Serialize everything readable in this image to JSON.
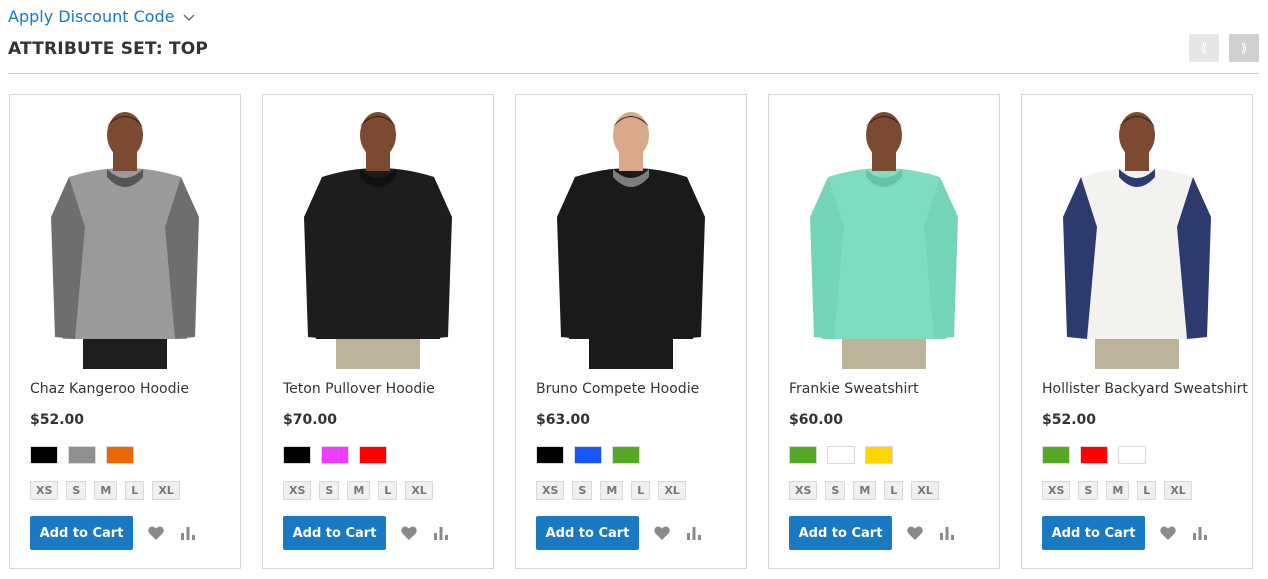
{
  "discount": {
    "label": "Apply Discount Code"
  },
  "section": {
    "title": "ATTRIBUTE SET: TOP"
  },
  "carousel": {
    "prev_glyph": "⟪",
    "next_glyph": "⟫"
  },
  "colors": {
    "accent": "#1979c3",
    "border": "#d6d6d6"
  },
  "products": [
    {
      "name": "Chaz Kangeroo Hoodie",
      "price": "$52.00",
      "swatches": [
        "#000000",
        "#8f8f8f",
        "#eb6703"
      ],
      "sizes": [
        "XS",
        "S",
        "M",
        "L",
        "XL"
      ],
      "cart_label": "Add to Cart",
      "garment": {
        "body": "#9a9a9a",
        "sleeve": "#6e6e6e",
        "trim": "#555555",
        "skin": "#7b4a30",
        "pants": "#1e1e1e"
      }
    },
    {
      "name": "Teton Pullover Hoodie",
      "price": "$70.00",
      "swatches": [
        "#000000",
        "#ef3dff",
        "#ff0000"
      ],
      "sizes": [
        "XS",
        "S",
        "M",
        "L",
        "XL"
      ],
      "cart_label": "Add to Cart",
      "garment": {
        "body": "#1d1d1d",
        "sleeve": "#1d1d1d",
        "trim": "#111111",
        "skin": "#7b4a30",
        "pants": "#bdb29a"
      }
    },
    {
      "name": "Bruno Compete Hoodie",
      "price": "$63.00",
      "swatches": [
        "#000000",
        "#1857f7",
        "#53a828"
      ],
      "sizes": [
        "XS",
        "S",
        "M",
        "L",
        "XL"
      ],
      "cart_label": "Add to Cart",
      "garment": {
        "body": "#1a1a1a",
        "sleeve": "#1a1a1a",
        "trim": "#7d7d7d",
        "skin": "#d9a88a",
        "pants": "#1a1a1a"
      }
    },
    {
      "name": "Frankie Sweatshirt",
      "price": "$60.00",
      "swatches": [
        "#53a828",
        "#ffffff",
        "#ffd500"
      ],
      "sizes": [
        "XS",
        "S",
        "M",
        "L",
        "XL"
      ],
      "cart_label": "Add to Cart",
      "garment": {
        "body": "#7fdcc1",
        "sleeve": "#74d4b8",
        "trim": "#65c4a8",
        "skin": "#7b4a30",
        "pants": "#bdb29a"
      }
    },
    {
      "name": "Hollister Backyard Sweatshirt",
      "price": "$52.00",
      "swatches": [
        "#53a828",
        "#ff0000",
        "#ffffff"
      ],
      "sizes": [
        "XS",
        "S",
        "M",
        "L",
        "XL"
      ],
      "cart_label": "Add to Cart",
      "garment": {
        "body": "#f4f2ee",
        "sleeve": "#2d3a6e",
        "trim": "#2d3a6e",
        "skin": "#7b4a30",
        "pants": "#bdb29a"
      }
    }
  ]
}
